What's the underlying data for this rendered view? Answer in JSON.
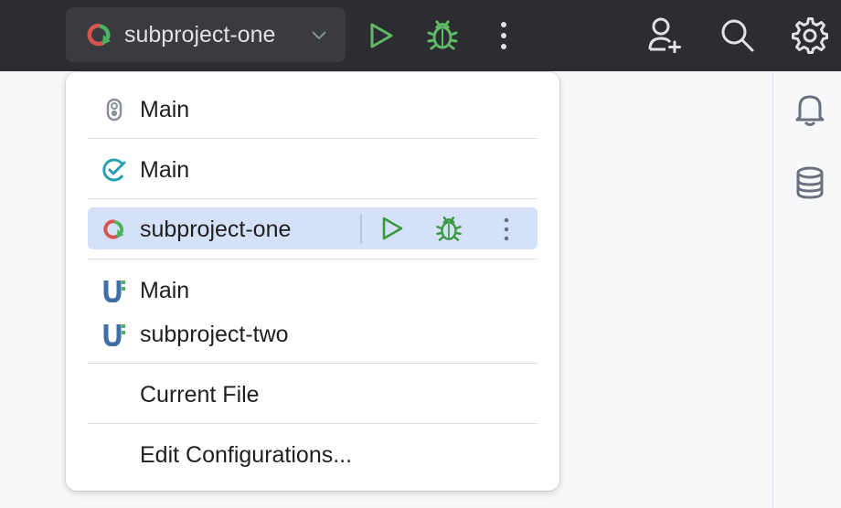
{
  "toolbar": {
    "run_config": {
      "label": "subproject-one",
      "icon": "gradle-run-icon"
    },
    "buttons": [
      "run-icon",
      "debug-icon",
      "more-vertical-icon",
      "add-user-icon",
      "search-icon",
      "settings-icon"
    ]
  },
  "right_strip": {
    "buttons": [
      "notifications-icon",
      "database-icon"
    ]
  },
  "popup": {
    "items": [
      {
        "label": "Main",
        "icon": "java-application-icon"
      },
      {
        "label": "Main",
        "icon": "test-config-icon"
      },
      {
        "label": "subproject-one",
        "icon": "gradle-run-icon",
        "selected": true
      },
      {
        "label": "Main",
        "icon": "gradle-module-icon"
      },
      {
        "label": "subproject-two",
        "icon": "gradle-module-icon"
      },
      {
        "label": "Current File",
        "icon": ""
      },
      {
        "label": "Edit Configurations...",
        "icon": ""
      }
    ]
  },
  "colors": {
    "toolbar_bg": "#2b2d30",
    "run_green": "#5fb865",
    "selection": "#d5e1f8",
    "popup_bg": "#ffffff"
  }
}
